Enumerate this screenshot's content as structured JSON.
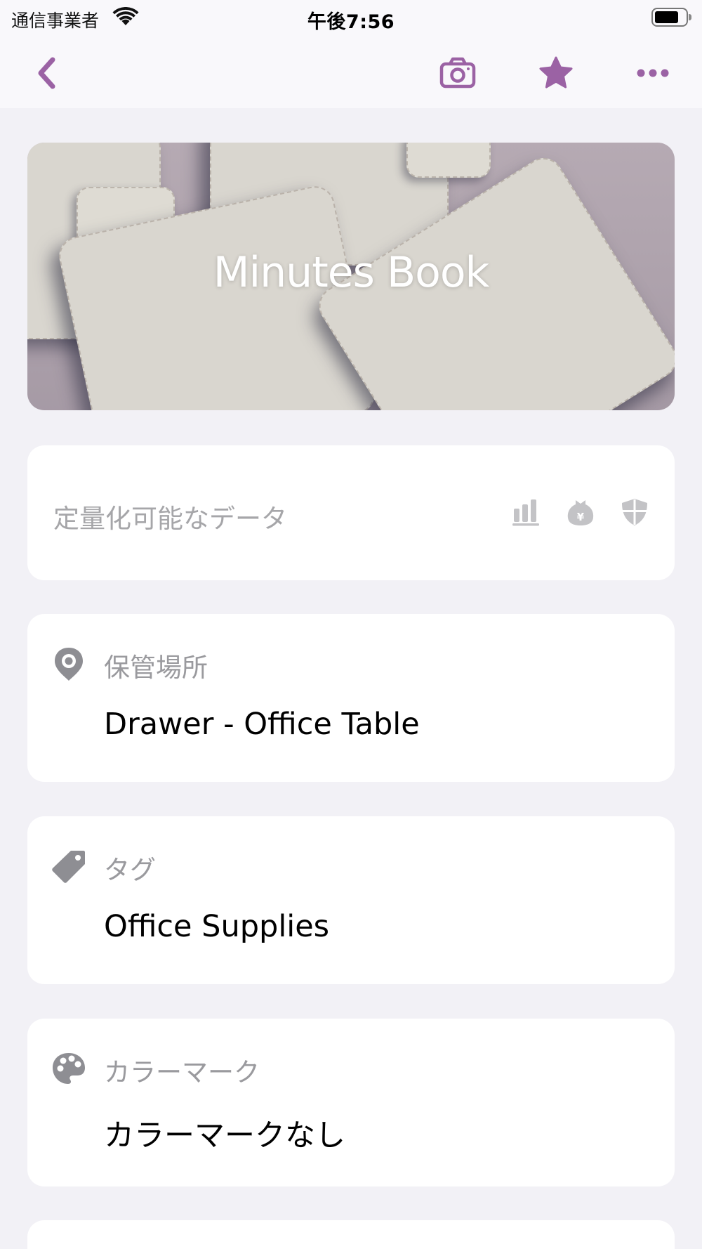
{
  "status_bar": {
    "carrier": "通信事業者",
    "time": "午後7:56",
    "battery_level": 0.7
  },
  "nav": {
    "back_icon": "chevron-left-icon",
    "camera_icon": "camera-icon",
    "favorite_icon": "star-icon",
    "more_icon": "ellipsis-icon",
    "accent_color": "#9b62a4"
  },
  "hero": {
    "title": "Minutes Book"
  },
  "quantifiable": {
    "label": "定量化可能なデータ",
    "icons": [
      "chart-icon",
      "money-bag-icon",
      "shield-icon"
    ]
  },
  "fields": [
    {
      "icon": "location-pin-icon",
      "label": "保管場所",
      "value": "Drawer - Office Table"
    },
    {
      "icon": "tag-icon",
      "label": "タグ",
      "value": "Office Supplies"
    },
    {
      "icon": "palette-icon",
      "label": "カラーマーク",
      "value": "カラーマークなし"
    }
  ]
}
